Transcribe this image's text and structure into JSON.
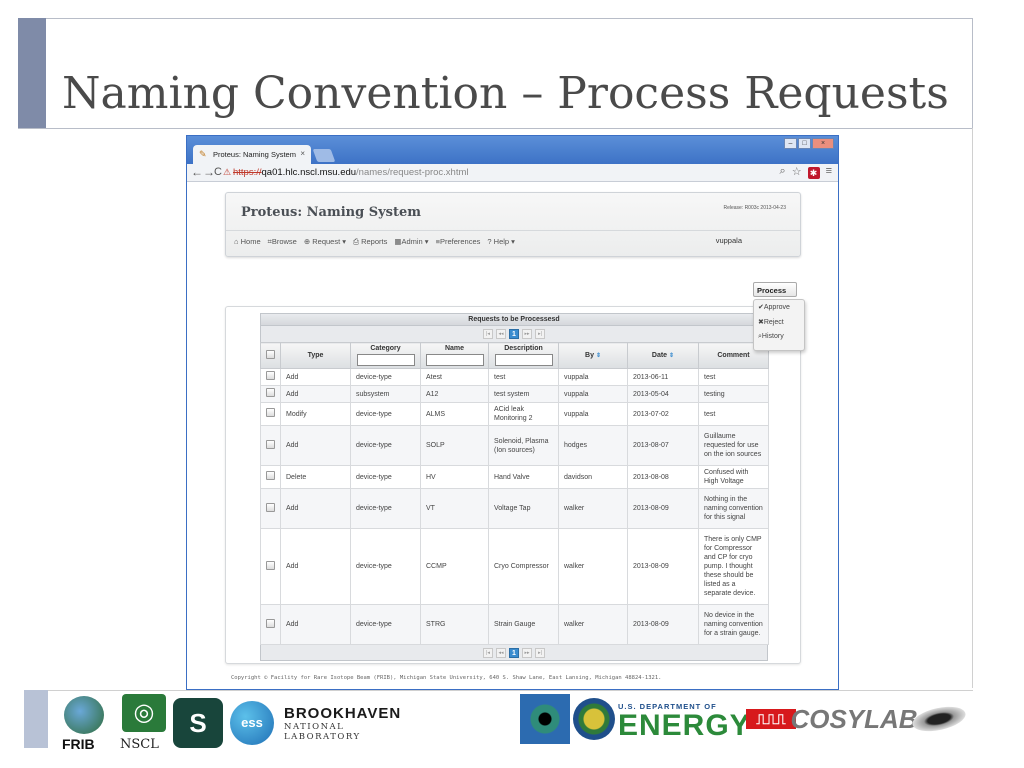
{
  "slide": {
    "title": "Naming Convention – Process Requests"
  },
  "browser": {
    "tab_title": "Proteus: Naming System",
    "tab_close": "×",
    "url_scheme": "https://",
    "url_host": "qa01.hlc.nscl.msu.edu",
    "url_path": "/names/request-proc.xhtml"
  },
  "app": {
    "title": "Proteus: Naming System",
    "release": "Release: R003c 2013-04-23",
    "nav": [
      {
        "label": "⌂ Home"
      },
      {
        "label": "⌗Browse"
      },
      {
        "label": "⊕ Request ▾"
      },
      {
        "label": "⎙ Reports"
      },
      {
        "label": "▦Admin ▾"
      },
      {
        "label": "≡Preferences"
      },
      {
        "label": "? Help ▾"
      }
    ],
    "user": "vuppala"
  },
  "process_menu": {
    "button_label": "Process",
    "items": [
      {
        "label": "✔Approve"
      },
      {
        "label": "✖Reject"
      },
      {
        "label": "⌕History"
      }
    ]
  },
  "table": {
    "caption": "Requests to be Processesd",
    "pager_current": "1",
    "columns": {
      "type": "Type",
      "category": "Category",
      "name": "Name",
      "description": "Description",
      "by": "By",
      "date": "Date",
      "comment": "Comment"
    },
    "rows": [
      {
        "type": "Add",
        "category": "device-type",
        "name": "Atest",
        "description": "test",
        "by": "vuppala",
        "date": "2013-06-11",
        "comment": "test"
      },
      {
        "type": "Add",
        "category": "subsystem",
        "name": "A12",
        "description": "test system",
        "by": "vuppala",
        "date": "2013-05-04",
        "comment": "testing"
      },
      {
        "type": "Modify",
        "category": "device-type",
        "name": "ALMS",
        "description": "ACid leak Monitoring 2",
        "by": "vuppala",
        "date": "2013-07-02",
        "comment": "test"
      },
      {
        "type": "Add",
        "category": "device-type",
        "name": "SOLP",
        "description": "Solenoid, Plasma (Ion sources)",
        "by": "hodges",
        "date": "2013-08-07",
        "comment": "Guillaume requested for use on the ion sources"
      },
      {
        "type": "Delete",
        "category": "device-type",
        "name": "HV",
        "description": "Hand Valve",
        "by": "davidson",
        "date": "2013-08-08",
        "comment": "Confused with High Voltage"
      },
      {
        "type": "Add",
        "category": "device-type",
        "name": "VT",
        "description": "Voltage Tap",
        "by": "walker",
        "date": "2013-08-09",
        "comment": "Nothing in the naming convention for this signal"
      },
      {
        "type": "Add",
        "category": "device-type",
        "name": "CCMP",
        "description": "Cryo Compressor",
        "by": "walker",
        "date": "2013-08-09",
        "comment": "There is only CMP for Compressor and CP for cryo pump. I thought these should be listed as a separate device."
      },
      {
        "type": "Add",
        "category": "device-type",
        "name": "STRG",
        "description": "Strain Gauge",
        "by": "walker",
        "date": "2013-08-09",
        "comment": "No device in the naming convention for a strain gauge."
      }
    ]
  },
  "copyright": "Copyright © Facility for Rare Isotope Beam (FRIB), Michigan State University, 640 S. Shaw Lane, East Lansing, Michigan 48824-1321.",
  "footer_logos": {
    "frib": "FRIB",
    "nscl": "NSCL",
    "bnl_name": "BROOKHAVEN",
    "bnl_sub": "NATIONAL LABORATORY",
    "doe_dept": "U.S. DEPARTMENT OF",
    "doe_word": "ENERGY",
    "cosylab": "COSYLAB"
  },
  "colors": {
    "accent_bar": "#7f8ba8",
    "browser_chrome": "#3d72c6",
    "pager_active": "#3a8ccf"
  }
}
